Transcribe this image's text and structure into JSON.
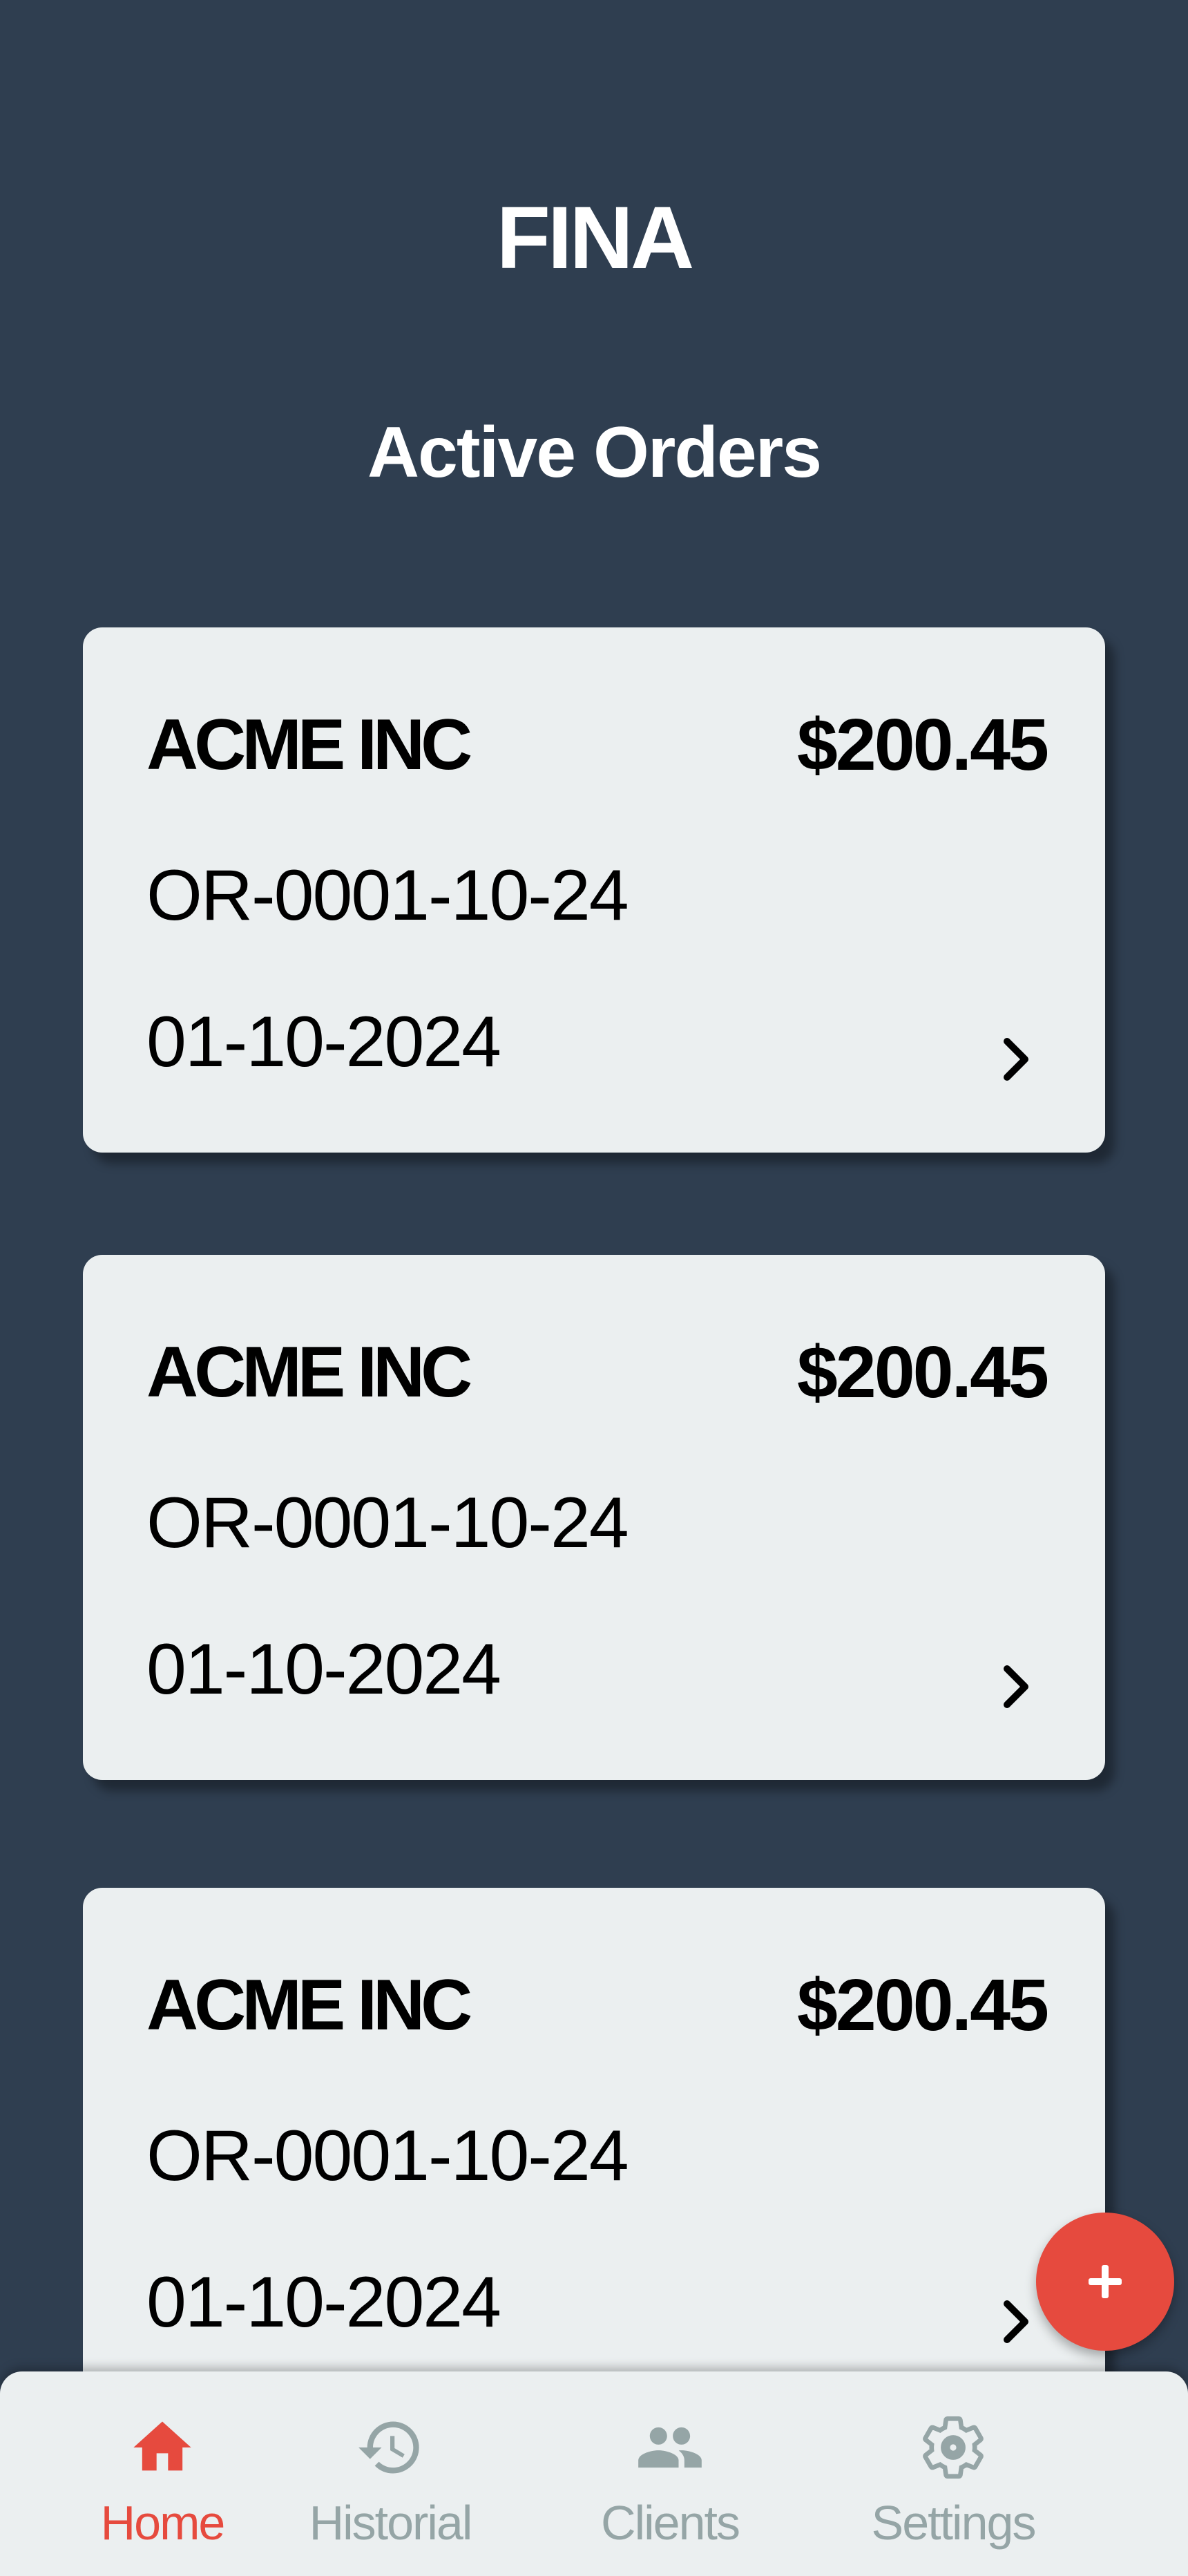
{
  "app": {
    "title": "FINA"
  },
  "header": {
    "section_title": "Active Orders"
  },
  "orders": [
    {
      "client": "ACME INC",
      "amount": "$200.45",
      "order_number": "OR-0001-10-24",
      "date": "01-10-2024"
    },
    {
      "client": "ACME INC",
      "amount": "$200.45",
      "order_number": "OR-0001-10-24",
      "date": "01-10-2024"
    },
    {
      "client": "ACME INC",
      "amount": "$200.45",
      "order_number": "OR-0001-10-24",
      "date": "01-10-2024"
    }
  ],
  "fab": {
    "icon": "plus-icon"
  },
  "bottom_nav": {
    "items": [
      {
        "label": "Home",
        "icon": "home-icon",
        "active": true
      },
      {
        "label": "Historial",
        "icon": "history-icon",
        "active": false
      },
      {
        "label": "Clients",
        "icon": "people-icon",
        "active": false
      },
      {
        "label": "Settings",
        "icon": "gear-icon",
        "active": false
      }
    ]
  },
  "colors": {
    "background": "#2f3e50",
    "card": "#ebeff0",
    "accent": "#e64a3e",
    "inactive": "#95a5a6"
  }
}
